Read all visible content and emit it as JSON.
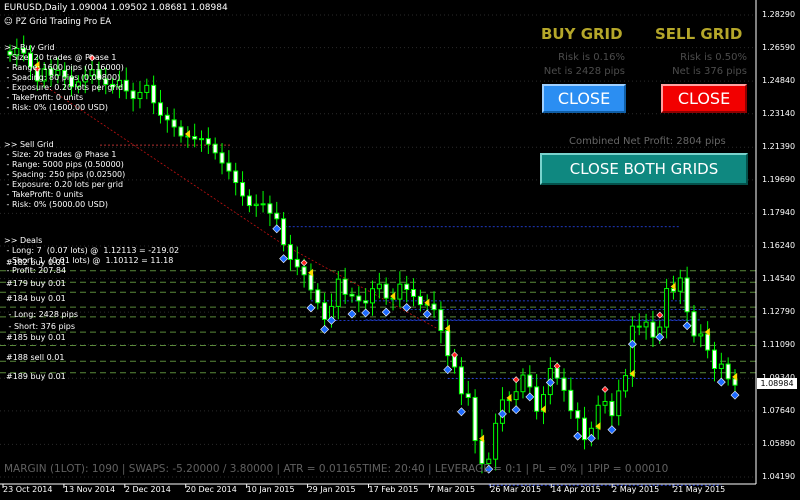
{
  "window": {
    "title": "EURUSD,Daily  1.09004 1.09502 1.08681 1.08984",
    "ea_name": "PZ Grid Trading Pro EA"
  },
  "panel": {
    "buy": {
      "title": "BUY GRID",
      "risk": "Risk is 0.16%",
      "net": "Net is 2428 pips",
      "close_label": "CLOSE"
    },
    "sell": {
      "title": "SELL GRID",
      "risk": "Risk is 0.50%",
      "net": "Net is 376 pips",
      "close_label": "CLOSE"
    },
    "combined": "Combined Net Profit: 2804 pips",
    "close_both_label": "CLOSE BOTH GRIDS"
  },
  "info": {
    "buy_grid": [
      ">> Buy Grid",
      " - Size: 20 trades @ Phase 1",
      " - Range: 1600 pips (0.16000)",
      " - Spacing: 80 pips (0.00800)",
      " - Exposure: 0.20 lots per grid",
      " - TakeProfit: 0 units",
      " - Risk: 0% (1600.00 USD)"
    ],
    "sell_grid": [
      ">> Sell Grid",
      " - Size: 20 trades @ Phase 1",
      " - Range: 5000 pips (0.50000)",
      " - Spacing: 250 pips (0.02500)",
      " - Exposure: 0.20 lots per grid",
      " - TakeProfit: 0 units",
      " - Risk: 0% (5000.00 USD)"
    ],
    "deals": [
      ">> Deals",
      " - Long: 7  (0.07 lots) @  1.12113 = -219.02",
      " - Short: 1  (0.01 lots) @  1.10112 = 11.18",
      " - Profit: 207.84"
    ],
    "trade_labels": [
      {
        "text": "#182 buy 0.01"
      },
      {
        "text": "#179 buy 0.01"
      },
      {
        "text": "#184 buy 0.01"
      },
      {
        "text": " - Long: 2428 pips"
      },
      {
        "text": " - Short: 376 pips"
      },
      {
        "text": "#185 buy 0.01"
      },
      {
        "text": "#188 sell 0.01"
      },
      {
        "text": "#189 buy 0.01"
      }
    ]
  },
  "status_bar": "MARGIN (1LOT): 1090 | SWAPS: -5.20000 / 3.80000 | ATR = 0.01165TIME: 20:40 | LEVERAGE = 0:1 | PL = 0% | 1PIP = 0.00010",
  "price_box": "1.08984",
  "colors": {
    "candle": "#00ff00",
    "bull_body": "#000000",
    "bear_body": "#ffffff",
    "grid_line": "#5a8a3a",
    "buy_arrow": "#1e6bff",
    "sell_arrow": "#ff2020",
    "close_mark": "#ffd700"
  },
  "chart_data": {
    "type": "candlestick",
    "symbol": "EURUSD",
    "timeframe": "Daily",
    "ohlc_last": {
      "open": 1.09004,
      "high": 1.09502,
      "low": 1.08681,
      "close": 1.08984
    },
    "y_ticks": [
      "1.28290",
      "1.26590",
      "1.24840",
      "1.23140",
      "1.21390",
      "1.19690",
      "1.17940",
      "1.16240",
      "1.14540",
      "1.12790",
      "1.11090",
      "1.09340",
      "1.07640",
      "1.05890",
      "1.04190"
    ],
    "x_ticks": [
      "23 Oct 2014",
      "13 Nov 2014",
      "2 Dec 2014",
      "20 Dec 2014",
      "10 Jan 2015",
      "29 Jan 2015",
      "17 Feb 2015",
      "7 Mar 2015",
      "26 Mar 2015",
      "14 Apr 2015",
      "2 May 2015",
      "21 May 2015"
    ],
    "ylim": [
      1.0419,
      1.2829
    ],
    "close_series": [
      1.262,
      1.2655,
      1.263,
      1.2558,
      1.2485,
      1.2548,
      1.2515,
      1.254,
      1.2506,
      1.2455,
      1.248,
      1.2512,
      1.2543,
      1.2495,
      1.2467,
      1.2454,
      1.2488,
      1.2433,
      1.2393,
      1.2425,
      1.2462,
      1.2371,
      1.2306,
      1.2282,
      1.2245,
      1.2198,
      1.2195,
      1.2182,
      1.2184,
      1.2155,
      1.211,
      1.2057,
      1.2015,
      1.1955,
      1.1885,
      1.1835,
      1.1842,
      1.1844,
      1.1795,
      1.1766,
      1.1631,
      1.1554,
      1.1515,
      1.1474,
      1.1395,
      1.1328,
      1.1241,
      1.1309,
      1.1451,
      1.1372,
      1.1363,
      1.1338,
      1.1327,
      1.1401,
      1.1425,
      1.1352,
      1.1347,
      1.1425,
      1.1397,
      1.1361,
      1.1318,
      1.1321,
      1.1292,
      1.1183,
      1.1052,
      1.0993,
      1.0853,
      1.0834,
      1.0609,
      1.0489,
      1.0512,
      1.0699,
      1.0821,
      1.0823,
      1.0864,
      1.0951,
      1.0889,
      1.0762,
      1.0849,
      1.0985,
      1.0935,
      1.0871,
      1.0765,
      1.0726,
      1.0614,
      1.0673,
      1.0793,
      1.0813,
      1.0739,
      1.0868,
      1.0948,
      1.1206,
      1.1202,
      1.1227,
      1.1148,
      1.1201,
      1.1402,
      1.1388,
      1.1457,
      1.1281,
      1.1155,
      1.1165,
      1.1081,
      1.0985,
      1.1008,
      1.0931,
      1.0898
    ]
  }
}
